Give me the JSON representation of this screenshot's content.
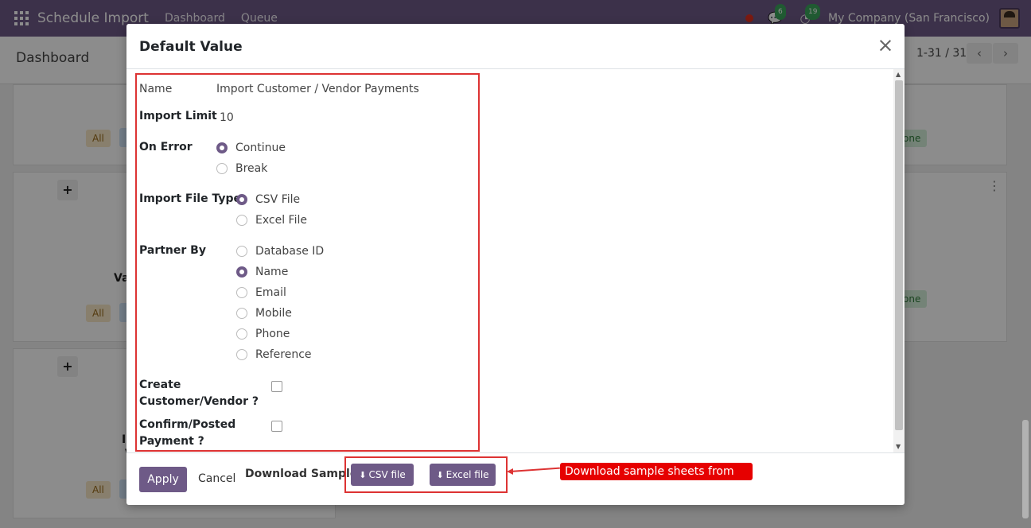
{
  "navbar": {
    "app_title": "Schedule Import",
    "links": [
      "Dashboard",
      "Queue"
    ],
    "messages_count": "6",
    "activities_count": "19",
    "company": "My Company (San Francisco)"
  },
  "control_bar": {
    "breadcrumb": "Dashboard",
    "pager": "1-31 / 31",
    "prev_icon": "‹",
    "next_icon": "›"
  },
  "background": {
    "tag_all": "All",
    "tag_done": "one",
    "card_text_1": "Va",
    "card_text_2": "I",
    "card_text_3": "V",
    "plus": "+"
  },
  "modal": {
    "title": "Default Value",
    "close_icon": "×",
    "fields": {
      "name_label": "Name",
      "name_value": "Import Customer / Vendor Payments",
      "import_limit_label": "Import Limit",
      "import_limit_value": "10",
      "on_error_label": "On Error",
      "on_error_options": [
        "Continue",
        "Break"
      ],
      "on_error_selected": "Continue",
      "file_type_label": "Import File Type",
      "file_type_options": [
        "CSV File",
        "Excel File"
      ],
      "file_type_selected": "CSV File",
      "partner_by_label": "Partner By",
      "partner_by_options": [
        "Database ID",
        "Name",
        "Email",
        "Mobile",
        "Phone",
        "Reference"
      ],
      "partner_by_selected": "Name",
      "create_partner_label_1": "Create",
      "create_partner_label_2": "Customer/Vendor ?",
      "create_partner_checked": false,
      "confirm_payment_label_1": "Confirm/Posted",
      "confirm_payment_label_2": "Payment ?",
      "confirm_payment_checked": false
    },
    "footer": {
      "apply_label": "Apply",
      "cancel_label": "Cancel",
      "download_label": "Download Sample:",
      "csv_button": "CSV file",
      "excel_button": "Excel file"
    }
  },
  "annotation": {
    "text": "Download sample sheets from here",
    "color": "#e60000"
  },
  "colors": {
    "brand": "#6e5a87",
    "highlight": "#dd3333"
  }
}
